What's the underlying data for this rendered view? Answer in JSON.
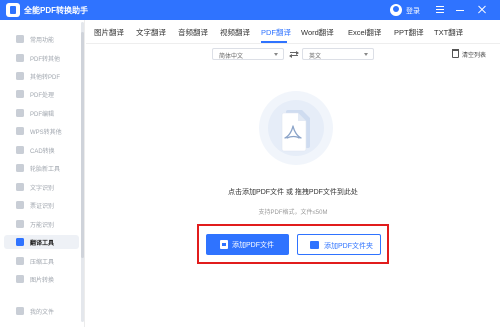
{
  "app": {
    "title": "全能PDF转换助手",
    "login_label": "登录"
  },
  "sidebar": {
    "items": [
      {
        "label": "常用功能",
        "icon": "star-icon"
      },
      {
        "label": "PDF转其他",
        "icon": "pdf-export-icon"
      },
      {
        "label": "其他转PDF",
        "icon": "pdf-import-icon"
      },
      {
        "label": "PDF处理",
        "icon": "pdf-process-icon"
      },
      {
        "label": "PDF编辑",
        "icon": "pdf-edit-icon"
      },
      {
        "label": "WPS转其他",
        "icon": "wps-icon"
      },
      {
        "label": "CAD转换",
        "icon": "cad-icon"
      },
      {
        "label": "轮胎新工具",
        "icon": "tool-icon"
      },
      {
        "label": "文字识别",
        "icon": "ocr-icon"
      },
      {
        "label": "票证识别",
        "icon": "ticket-icon"
      },
      {
        "label": "万能识别",
        "icon": "scan-icon"
      },
      {
        "label": "翻译工具",
        "icon": "translate-icon",
        "active": true
      },
      {
        "label": "压缩工具",
        "icon": "compress-icon"
      },
      {
        "label": "图片转换",
        "icon": "image-icon"
      },
      {
        "label": "我的文件",
        "icon": "folder-icon"
      }
    ]
  },
  "tabs": [
    {
      "label": "图片翻译"
    },
    {
      "label": "文字翻译"
    },
    {
      "label": "音频翻译"
    },
    {
      "label": "视频翻译"
    },
    {
      "label": "PDF翻译",
      "active": true
    },
    {
      "label": "Word翻译"
    },
    {
      "label": "Excel翻译"
    },
    {
      "label": "PPT翻译"
    },
    {
      "label": "TXT翻译"
    }
  ],
  "toolbar": {
    "source_language": "简体中文",
    "target_language": "英文",
    "clear_list_label": "清空列表"
  },
  "upload": {
    "headline": "点击添加PDF文件 或 拖拽PDF文件到此处",
    "hint": "支持PDF格式，文件≤50M",
    "add_file_label": "添加PDF文件",
    "add_folder_label": "添加PDF文件夹"
  },
  "colors": {
    "accent": "#2f73ff",
    "highlight_box": "#e11c1c"
  }
}
